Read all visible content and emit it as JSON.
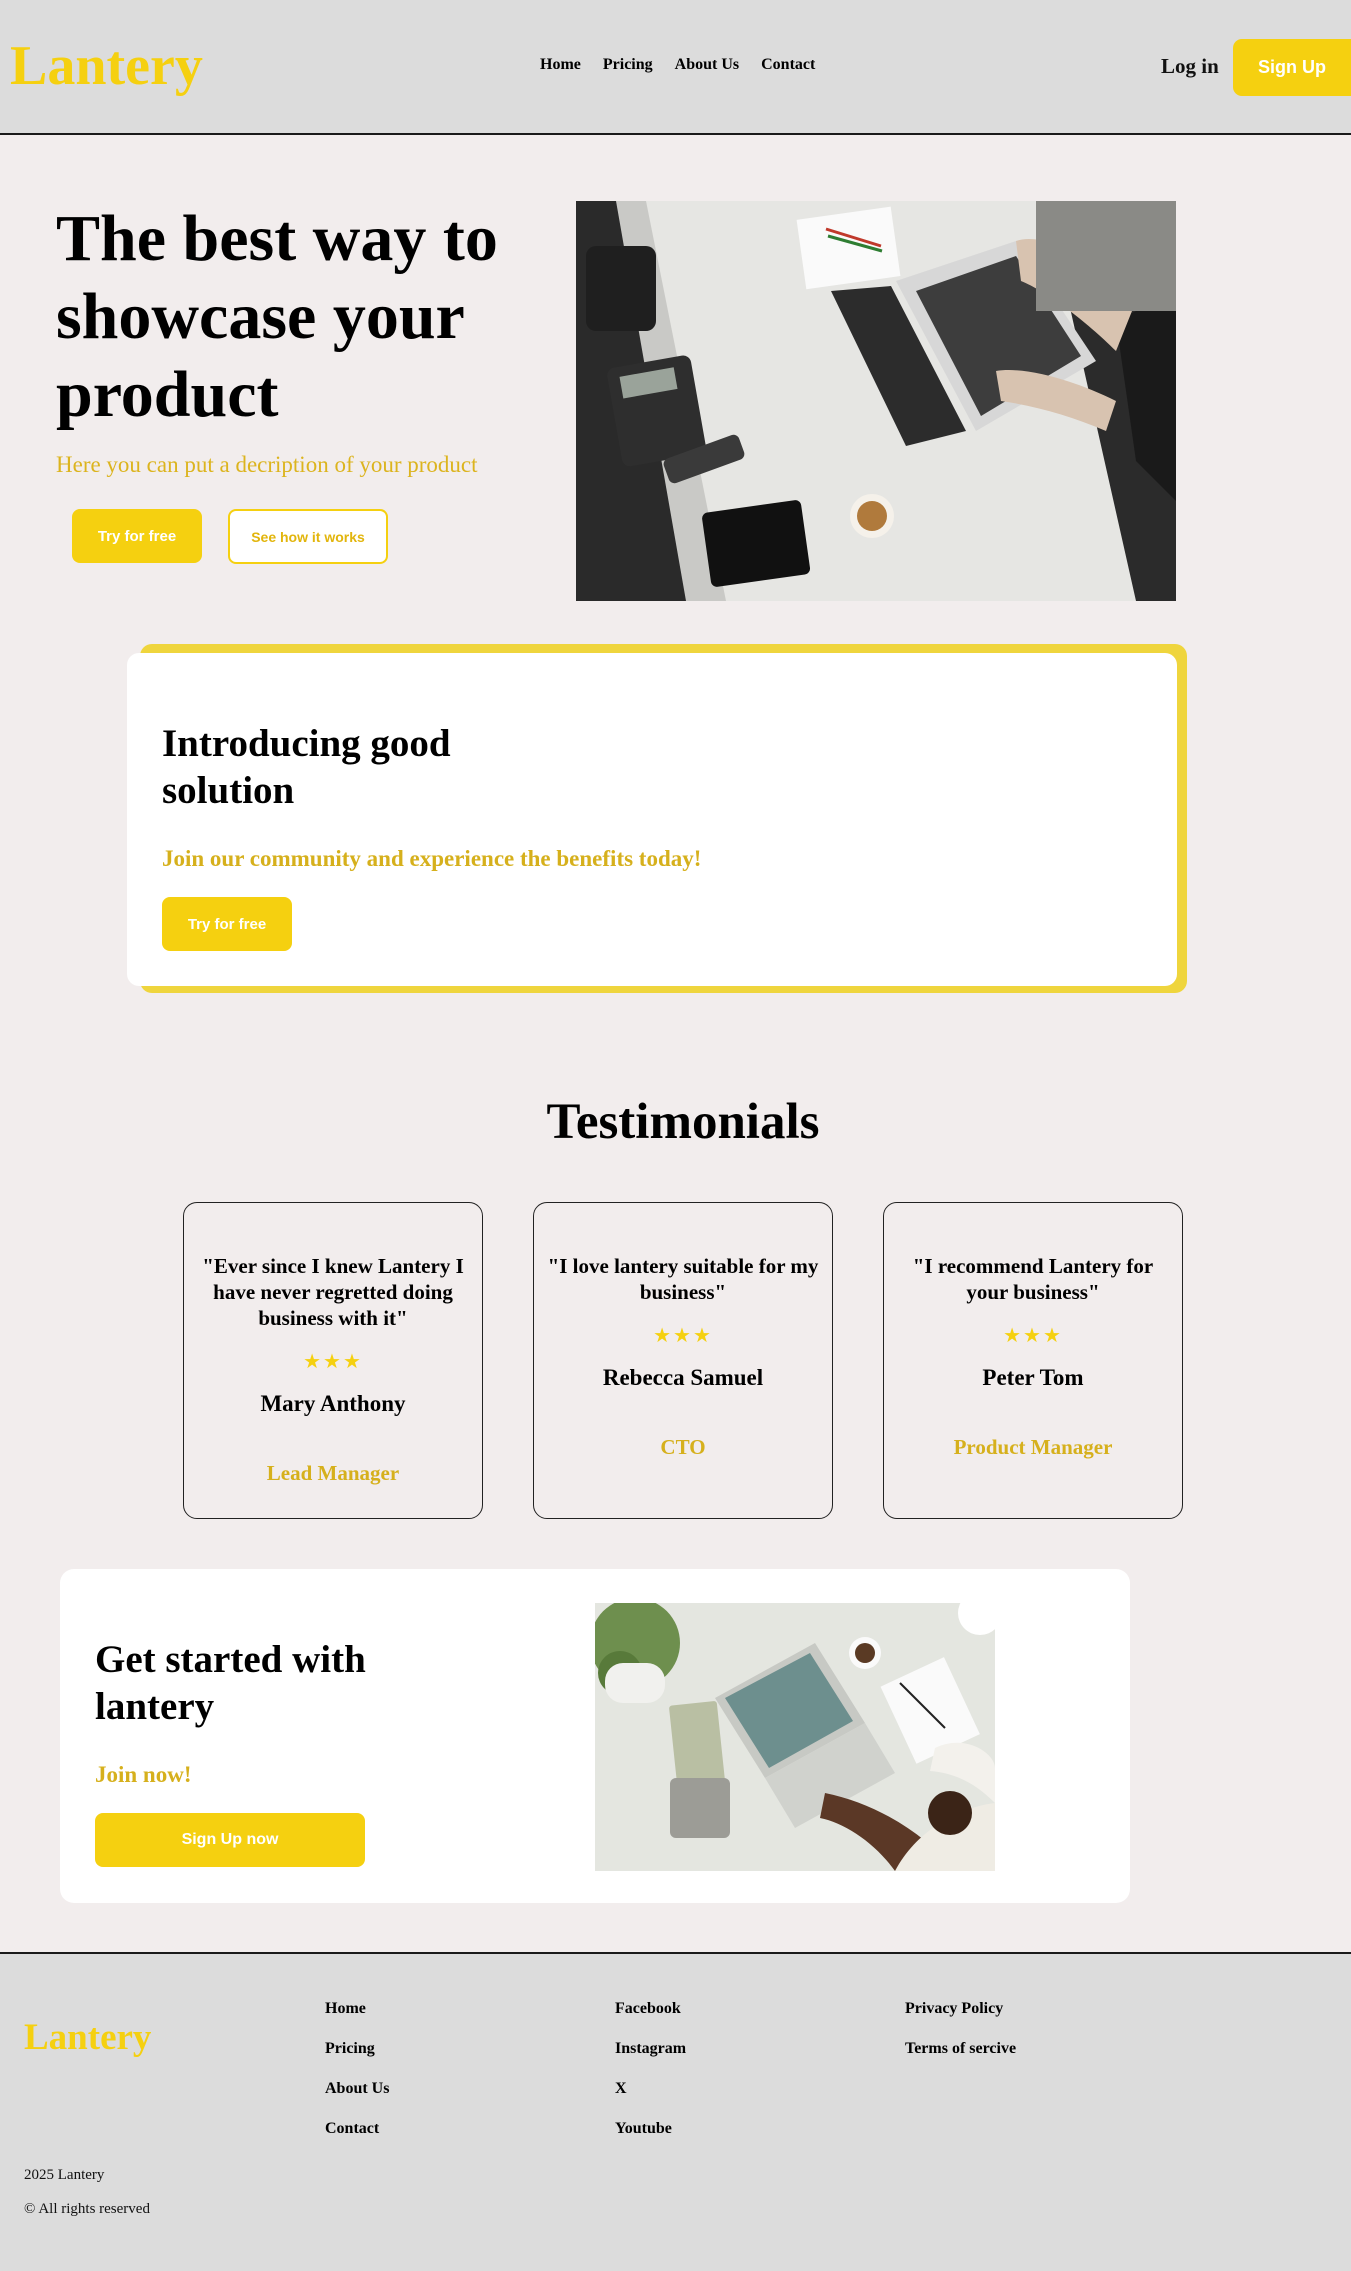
{
  "brand": {
    "name": "Lantery",
    "accent": "#f5d010"
  },
  "nav": {
    "items": [
      "Home",
      "Pricing",
      "About Us",
      "Contact"
    ],
    "login": "Log in",
    "signup": "Sign Up"
  },
  "hero": {
    "title": "The best way to showcase your product",
    "description": "Here you can put a decription of your product",
    "primary_cta": "Try for free",
    "secondary_cta": "See how it works"
  },
  "intro": {
    "title": "Introducing good solution",
    "subtitle": "Join our community and experience the benefits today!",
    "cta": "Try for free"
  },
  "testimonials": {
    "heading": "Testimonials",
    "items": [
      {
        "quote": "\"Ever since I knew Lantery I have never regretted doing business with it\"",
        "stars": "★★★",
        "name": "Mary Anthony",
        "role": "Lead Manager"
      },
      {
        "quote": "\"I love lantery suitable for my business\"",
        "stars": "★★★",
        "name": "Rebecca Samuel",
        "role": "CTO"
      },
      {
        "quote": "\"I recommend Lantery for your business\"",
        "stars": "★★★",
        "name": "Peter Tom",
        "role": "Product Manager"
      }
    ]
  },
  "get_started": {
    "title": "Get started with lantery",
    "join": "Join now!",
    "cta": "Sign Up now"
  },
  "footer": {
    "logo": "Lantery",
    "pages": [
      "Home",
      "Pricing",
      "About Us",
      "Contact"
    ],
    "social": [
      "Facebook",
      "Instagram",
      "X",
      "Youtube"
    ],
    "legal": [
      "Privacy Policy",
      "Terms of sercive"
    ],
    "year_line": "2025 Lantery",
    "rights": "© All rights reserved"
  }
}
